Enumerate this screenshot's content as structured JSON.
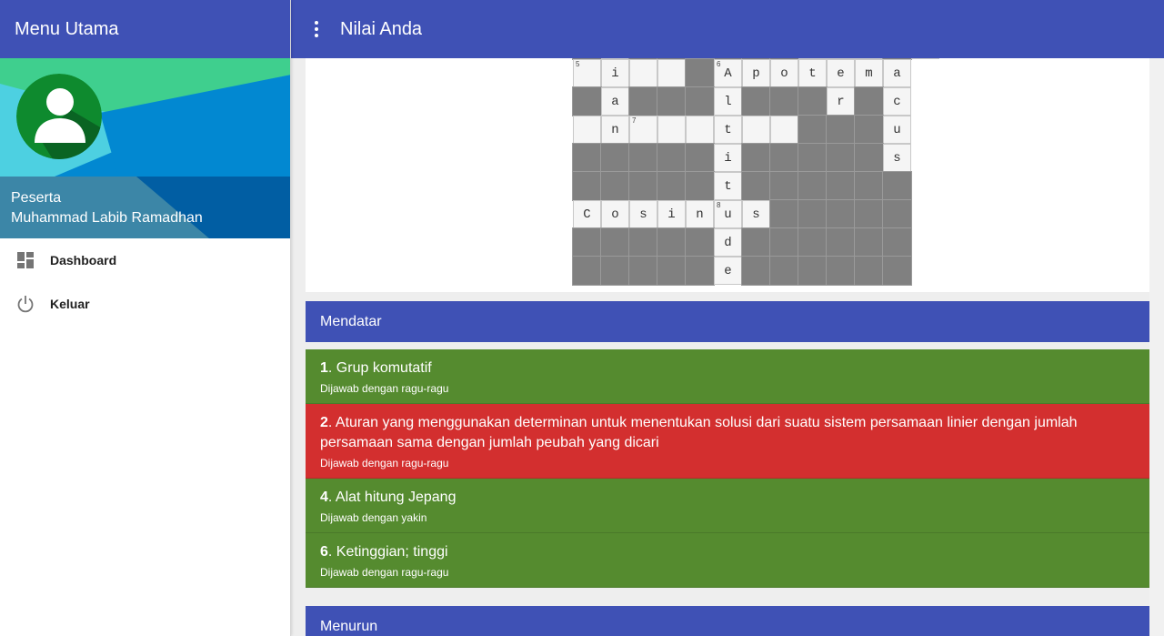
{
  "sidebar": {
    "title": "Menu Utama",
    "profile": {
      "role": "Peserta",
      "name": "Muhammad Labib Ramadhan"
    },
    "nav": [
      {
        "label": "Dashboard",
        "icon": "dashboard-icon"
      },
      {
        "label": "Keluar",
        "icon": "power-icon"
      }
    ]
  },
  "topbar": {
    "title": "Nilai Anda",
    "menu_icon": "more-vert-icon"
  },
  "colors": {
    "primary": "#3f51b5",
    "correct": "#558b2f",
    "wrong": "#d32f2f"
  },
  "crossword": {
    "rows": [
      "#.###### ..#.",
      ".i..#Apotema",
      "#a###l###r#c",
      ".n...t..###u",
      "#####i#####s",
      "#####t######",
      "Cosinus#####",
      "#####d######",
      "#####e######"
    ],
    "numbers": [
      {
        "row": 1,
        "col": 0,
        "n": "5"
      },
      {
        "row": 1,
        "col": 5,
        "n": "6"
      },
      {
        "row": 3,
        "col": 0,
        "n": "7"
      },
      {
        "row": 6,
        "col": 0,
        "n": "8"
      }
    ]
  },
  "mendatar": {
    "title": "Mendatar",
    "clues": [
      {
        "num": "1",
        "text": ". Grup komutatif",
        "status": "Dijawab dengan ragu-ragu",
        "result": "correct"
      },
      {
        "num": "2",
        "text": ". Aturan yang menggunakan determinan untuk menentukan solusi dari suatu sistem persamaan linier dengan jumlah persamaan sama dengan jumlah peubah yang dicari",
        "status": "Dijawab dengan ragu-ragu",
        "result": "wrong"
      },
      {
        "num": "4",
        "text": ". Alat hitung Jepang",
        "status": "Dijawab dengan yakin",
        "result": "correct"
      },
      {
        "num": "6",
        "text": ". Ketinggian; tinggi",
        "status": "Dijawab dengan ragu-ragu",
        "result": "correct"
      }
    ]
  },
  "menurun": {
    "title": "Menurun"
  }
}
